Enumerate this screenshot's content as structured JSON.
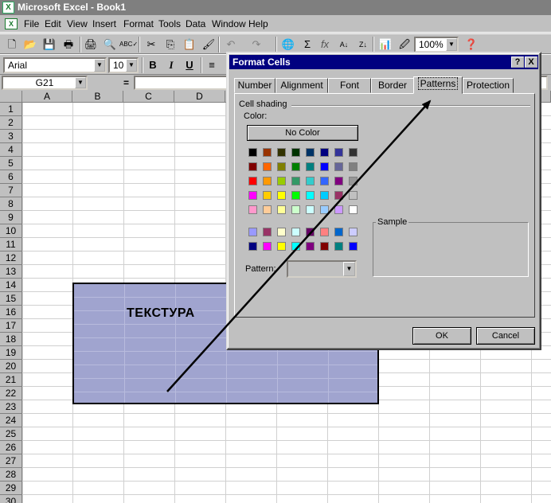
{
  "window": {
    "title": "Microsoft Excel - Book1",
    "app_icon": "excel-icon"
  },
  "menu": [
    {
      "label": "File"
    },
    {
      "label": "Edit"
    },
    {
      "label": "View"
    },
    {
      "label": "Insert"
    },
    {
      "label": "Format"
    },
    {
      "label": "Tools"
    },
    {
      "label": "Data"
    },
    {
      "label": "Window"
    },
    {
      "label": "Help"
    }
  ],
  "toolbar": {
    "zoom": "100%",
    "sigma": "Σ",
    "fx": "fx"
  },
  "format_toolbar": {
    "font": "Arial",
    "size": "10",
    "bold": "B",
    "italic": "I",
    "underline": "U"
  },
  "formula_bar": {
    "name_box": "G21",
    "equals": "="
  },
  "sheet": {
    "columns": [
      "A",
      "B",
      "C",
      "D"
    ],
    "rows": [
      "1",
      "2",
      "3",
      "4",
      "5",
      "6",
      "7",
      "8",
      "9",
      "10",
      "11",
      "12",
      "13",
      "14",
      "15",
      "16",
      "17",
      "18",
      "19",
      "20",
      "21",
      "22",
      "23",
      "24",
      "25",
      "26",
      "27",
      "28",
      "29",
      "30"
    ]
  },
  "annotation": {
    "label": "ТЕКСТУРА"
  },
  "dialog": {
    "title": "Format Cells",
    "help_btn": "?",
    "close_btn": "X",
    "tabs": [
      "Number",
      "Alignment",
      "Font",
      "Border",
      "Patterns",
      "Protection"
    ],
    "active_tab": "Patterns",
    "cell_shading": "Cell shading",
    "color_label": "Color:",
    "no_color": "No Color",
    "sample_label": "Sample",
    "pattern_label": "Pattern:",
    "ok": "OK",
    "cancel": "Cancel",
    "palette_main": [
      [
        "#000000",
        "#993300",
        "#333300",
        "#003300",
        "#003366",
        "#000080",
        "#333399",
        "#333333"
      ],
      [
        "#800000",
        "#FF6600",
        "#808000",
        "#008000",
        "#008080",
        "#0000FF",
        "#666699",
        "#808080"
      ],
      [
        "#FF0000",
        "#FF9900",
        "#99CC00",
        "#339966",
        "#33CCCC",
        "#3366FF",
        "#800080",
        "#969696"
      ],
      [
        "#FF00FF",
        "#FFCC00",
        "#FFFF00",
        "#00FF00",
        "#00FFFF",
        "#00CCFF",
        "#993366",
        "#C0C0C0"
      ],
      [
        "#FF99CC",
        "#FFCC99",
        "#FFFF99",
        "#CCFFCC",
        "#CCFFFF",
        "#99CCFF",
        "#CC99FF",
        "#FFFFFF"
      ]
    ],
    "palette_extra": [
      [
        "#9999FF",
        "#993366",
        "#FFFFCC",
        "#CCFFFF",
        "#660066",
        "#FF8080",
        "#0066CC",
        "#CCCCFF"
      ],
      [
        "#000080",
        "#FF00FF",
        "#FFFF00",
        "#00FFFF",
        "#800080",
        "#800000",
        "#008080",
        "#0000FF"
      ]
    ]
  }
}
